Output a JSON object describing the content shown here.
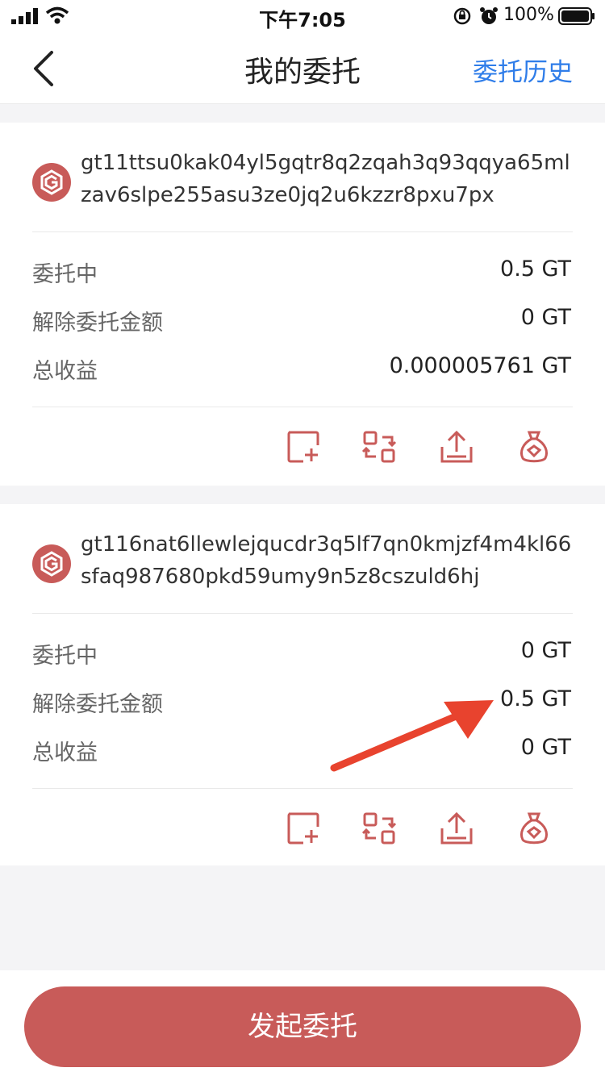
{
  "status": {
    "time": "下午7:05",
    "battery_pct": "100%"
  },
  "nav": {
    "title": "我的委托",
    "history_label": "委托历史"
  },
  "accent": {
    "brand_red": "#c85b59",
    "link_blue": "#2f7de9"
  },
  "delegations": [
    {
      "address": "gt11ttsu0kak04yl5gqtr8q2zqah3q93qqya65mlzav6slpe255asu3ze0jq2u6kzzr8pxu7px",
      "rows": [
        {
          "label": "委托中",
          "value": "0.5 GT"
        },
        {
          "label": "解除委托金额",
          "value": "0 GT"
        },
        {
          "label": "总收益",
          "value": "0.000005761 GT"
        }
      ],
      "actions": [
        "add-delegation-icon",
        "redelegate-icon",
        "undelegate-icon",
        "claim-reward-icon"
      ]
    },
    {
      "address": "gt116nat6llewlejqucdr3q5lf7qn0kmjzf4m4kl66sfaq987680pkd59umy9n5z8cszuld6hj",
      "rows": [
        {
          "label": "委托中",
          "value": "0 GT"
        },
        {
          "label": "解除委托金额",
          "value": "0.5 GT"
        },
        {
          "label": "总收益",
          "value": "0 GT"
        }
      ],
      "actions": [
        "add-delegation-icon",
        "redelegate-icon",
        "undelegate-icon",
        "claim-reward-icon"
      ]
    }
  ],
  "cta_label": "发起委托"
}
